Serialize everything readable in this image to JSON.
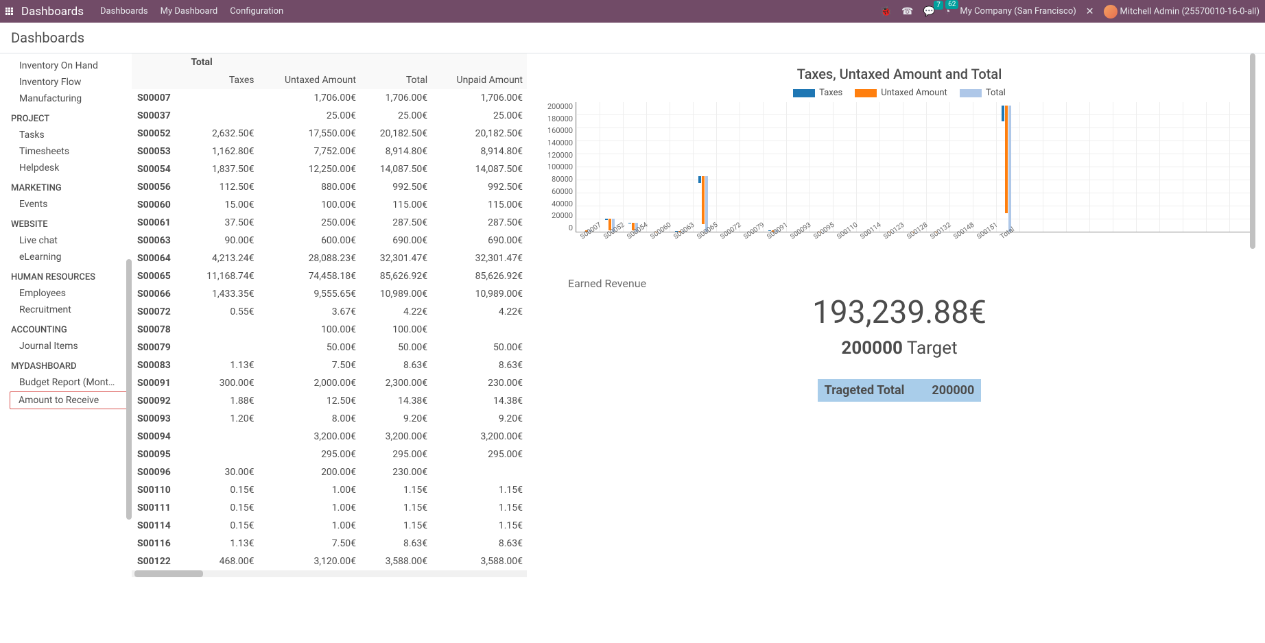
{
  "topbar": {
    "app_title": "Dashboards",
    "nav": [
      "Dashboards",
      "My Dashboard",
      "Configuration"
    ],
    "badge_conv": "7",
    "badge_clock": "62",
    "company": "My Company (San Francisco)",
    "user": "Mitchell Admin (25570010-16-0-all)"
  },
  "breadcrumb": "Dashboards",
  "sidebar": {
    "items": [
      {
        "label": "Inventory On Hand",
        "h": false
      },
      {
        "label": "Inventory Flow",
        "h": false
      },
      {
        "label": "Manufacturing",
        "h": false
      },
      {
        "label": "PROJECT",
        "h": true
      },
      {
        "label": "Tasks",
        "h": false
      },
      {
        "label": "Timesheets",
        "h": false
      },
      {
        "label": "Helpdesk",
        "h": false
      },
      {
        "label": "MARKETING",
        "h": true
      },
      {
        "label": "Events",
        "h": false
      },
      {
        "label": "WEBSITE",
        "h": true
      },
      {
        "label": "Live chat",
        "h": false
      },
      {
        "label": "eLearning",
        "h": false
      },
      {
        "label": "HUMAN RESOURCES",
        "h": true
      },
      {
        "label": "Employees",
        "h": false
      },
      {
        "label": "Recruitment",
        "h": false
      },
      {
        "label": "ACCOUNTING",
        "h": true
      },
      {
        "label": "Journal Items",
        "h": false
      },
      {
        "label": "MYDASHBOARD",
        "h": true
      },
      {
        "label": "Budget Report (Mont…",
        "h": false
      },
      {
        "label": "Amount to Receive",
        "h": false,
        "hl": true
      }
    ]
  },
  "table": {
    "super_header": "Total",
    "cols": [
      "Taxes",
      "Untaxed Amount",
      "Total",
      "Unpaid Amount"
    ],
    "rows": [
      {
        "id": "S00007",
        "taxes": "",
        "untaxed": "1,706.00€",
        "total": "1,706.00€",
        "unpaid": "1,706.00€"
      },
      {
        "id": "S00037",
        "taxes": "",
        "untaxed": "25.00€",
        "total": "25.00€",
        "unpaid": "25.00€"
      },
      {
        "id": "S00052",
        "taxes": "2,632.50€",
        "untaxed": "17,550.00€",
        "total": "20,182.50€",
        "unpaid": "20,182.50€"
      },
      {
        "id": "S00053",
        "taxes": "1,162.80€",
        "untaxed": "7,752.00€",
        "total": "8,914.80€",
        "unpaid": "8,914.80€"
      },
      {
        "id": "S00054",
        "taxes": "1,837.50€",
        "untaxed": "12,250.00€",
        "total": "14,087.50€",
        "unpaid": "14,087.50€"
      },
      {
        "id": "S00056",
        "taxes": "112.50€",
        "untaxed": "880.00€",
        "total": "992.50€",
        "unpaid": "992.50€"
      },
      {
        "id": "S00060",
        "taxes": "15.00€",
        "untaxed": "100.00€",
        "total": "115.00€",
        "unpaid": "115.00€"
      },
      {
        "id": "S00061",
        "taxes": "37.50€",
        "untaxed": "250.00€",
        "total": "287.50€",
        "unpaid": "287.50€"
      },
      {
        "id": "S00063",
        "taxes": "90.00€",
        "untaxed": "600.00€",
        "total": "690.00€",
        "unpaid": "690.00€"
      },
      {
        "id": "S00064",
        "taxes": "4,213.24€",
        "untaxed": "28,088.23€",
        "total": "32,301.47€",
        "unpaid": "32,301.47€"
      },
      {
        "id": "S00065",
        "taxes": "11,168.74€",
        "untaxed": "74,458.18€",
        "total": "85,626.92€",
        "unpaid": "85,626.92€"
      },
      {
        "id": "S00066",
        "taxes": "1,433.35€",
        "untaxed": "9,555.65€",
        "total": "10,989.00€",
        "unpaid": "10,989.00€"
      },
      {
        "id": "S00072",
        "taxes": "0.55€",
        "untaxed": "3.67€",
        "total": "4.22€",
        "unpaid": "4.22€"
      },
      {
        "id": "S00078",
        "taxes": "",
        "untaxed": "100.00€",
        "total": "100.00€",
        "unpaid": ""
      },
      {
        "id": "S00079",
        "taxes": "",
        "untaxed": "50.00€",
        "total": "50.00€",
        "unpaid": "50.00€"
      },
      {
        "id": "S00083",
        "taxes": "1.13€",
        "untaxed": "7.50€",
        "total": "8.63€",
        "unpaid": "8.63€"
      },
      {
        "id": "S00091",
        "taxes": "300.00€",
        "untaxed": "2,000.00€",
        "total": "2,300.00€",
        "unpaid": "230.00€"
      },
      {
        "id": "S00092",
        "taxes": "1.88€",
        "untaxed": "12.50€",
        "total": "14.38€",
        "unpaid": "14.38€"
      },
      {
        "id": "S00093",
        "taxes": "1.20€",
        "untaxed": "8.00€",
        "total": "9.20€",
        "unpaid": "9.20€"
      },
      {
        "id": "S00094",
        "taxes": "",
        "untaxed": "3,200.00€",
        "total": "3,200.00€",
        "unpaid": "3,200.00€"
      },
      {
        "id": "S00095",
        "taxes": "",
        "untaxed": "295.00€",
        "total": "295.00€",
        "unpaid": "295.00€"
      },
      {
        "id": "S00096",
        "taxes": "30.00€",
        "untaxed": "200.00€",
        "total": "230.00€",
        "unpaid": ""
      },
      {
        "id": "S00110",
        "taxes": "0.15€",
        "untaxed": "1.00€",
        "total": "1.15€",
        "unpaid": "1.15€"
      },
      {
        "id": "S00111",
        "taxes": "0.15€",
        "untaxed": "1.00€",
        "total": "1.15€",
        "unpaid": "1.15€"
      },
      {
        "id": "S00114",
        "taxes": "0.15€",
        "untaxed": "1.00€",
        "total": "1.15€",
        "unpaid": "1.15€"
      },
      {
        "id": "S00116",
        "taxes": "1.13€",
        "untaxed": "7.50€",
        "total": "8.63€",
        "unpaid": "8.63€"
      },
      {
        "id": "S00122",
        "taxes": "468.00€",
        "untaxed": "3,120.00€",
        "total": "3,588.00€",
        "unpaid": "3,588.00€"
      }
    ]
  },
  "chart": {
    "title": "Taxes, Untaxed Amount and Total",
    "legend": [
      "Taxes",
      "Untaxed Amount",
      "Total"
    ],
    "colors": {
      "taxes": "#1f77b4",
      "untaxed": "#ff7f0e",
      "total": "#aec7e8"
    },
    "y_ticks": [
      "200000",
      "180000",
      "160000",
      "140000",
      "120000",
      "100000",
      "80000",
      "60000",
      "40000",
      "20000",
      "0"
    ],
    "y_max": 200000
  },
  "revenue": {
    "label": "Earned Revenue",
    "value": "193,239.88€",
    "target_value": "200000",
    "target_word": "Target",
    "box_label": "Trageted Total",
    "box_value": "200000"
  },
  "chart_data": {
    "type": "bar",
    "title": "Taxes, Untaxed Amount and Total",
    "ylim": [
      0,
      200000
    ],
    "categories": [
      "S00007",
      "S00052",
      "S00054",
      "S00060",
      "S00063",
      "S00065",
      "S00072",
      "S00079",
      "S00091",
      "S00093",
      "S00095",
      "S00110",
      "S00114",
      "S00123",
      "S00128",
      "S00132",
      "S00148",
      "S00151",
      "Total"
    ],
    "series": [
      {
        "name": "Taxes",
        "color": "#1f77b4",
        "values": [
          0,
          2632,
          1837,
          15,
          90,
          11168,
          0.55,
          0,
          300,
          1.2,
          0,
          0.15,
          0.15,
          0,
          0,
          0,
          0,
          0,
          23800
        ]
      },
      {
        "name": "Untaxed Amount",
        "color": "#ff7f0e",
        "values": [
          1706,
          17550,
          12250,
          100,
          600,
          74458,
          3.67,
          50,
          2000,
          8,
          295,
          1,
          1,
          500,
          200,
          100,
          50,
          50,
          165000
        ]
      },
      {
        "name": "Total",
        "color": "#aec7e8",
        "values": [
          1706,
          20182,
          14087,
          115,
          690,
          85626,
          4.22,
          50,
          2300,
          9.2,
          295,
          1.15,
          1.15,
          500,
          200,
          100,
          50,
          50,
          193240
        ]
      }
    ]
  }
}
